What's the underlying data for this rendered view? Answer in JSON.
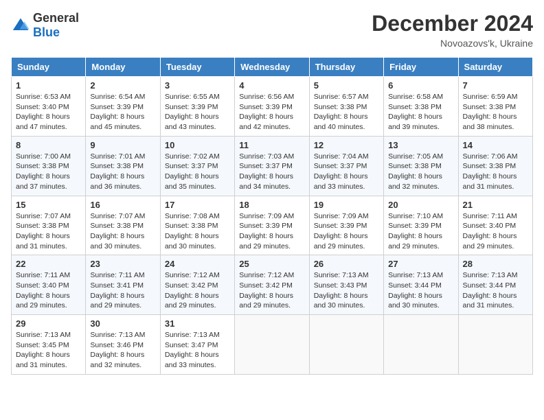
{
  "header": {
    "logo_general": "General",
    "logo_blue": "Blue",
    "month_year": "December 2024",
    "location": "Novoazovs'k, Ukraine"
  },
  "columns": [
    "Sunday",
    "Monday",
    "Tuesday",
    "Wednesday",
    "Thursday",
    "Friday",
    "Saturday"
  ],
  "weeks": [
    [
      {
        "day": "1",
        "sunrise": "6:53 AM",
        "sunset": "3:40 PM",
        "daylight": "8 hours and 47 minutes."
      },
      {
        "day": "2",
        "sunrise": "6:54 AM",
        "sunset": "3:39 PM",
        "daylight": "8 hours and 45 minutes."
      },
      {
        "day": "3",
        "sunrise": "6:55 AM",
        "sunset": "3:39 PM",
        "daylight": "8 hours and 43 minutes."
      },
      {
        "day": "4",
        "sunrise": "6:56 AM",
        "sunset": "3:39 PM",
        "daylight": "8 hours and 42 minutes."
      },
      {
        "day": "5",
        "sunrise": "6:57 AM",
        "sunset": "3:38 PM",
        "daylight": "8 hours and 40 minutes."
      },
      {
        "day": "6",
        "sunrise": "6:58 AM",
        "sunset": "3:38 PM",
        "daylight": "8 hours and 39 minutes."
      },
      {
        "day": "7",
        "sunrise": "6:59 AM",
        "sunset": "3:38 PM",
        "daylight": "8 hours and 38 minutes."
      }
    ],
    [
      {
        "day": "8",
        "sunrise": "7:00 AM",
        "sunset": "3:38 PM",
        "daylight": "8 hours and 37 minutes."
      },
      {
        "day": "9",
        "sunrise": "7:01 AM",
        "sunset": "3:38 PM",
        "daylight": "8 hours and 36 minutes."
      },
      {
        "day": "10",
        "sunrise": "7:02 AM",
        "sunset": "3:37 PM",
        "daylight": "8 hours and 35 minutes."
      },
      {
        "day": "11",
        "sunrise": "7:03 AM",
        "sunset": "3:37 PM",
        "daylight": "8 hours and 34 minutes."
      },
      {
        "day": "12",
        "sunrise": "7:04 AM",
        "sunset": "3:37 PM",
        "daylight": "8 hours and 33 minutes."
      },
      {
        "day": "13",
        "sunrise": "7:05 AM",
        "sunset": "3:38 PM",
        "daylight": "8 hours and 32 minutes."
      },
      {
        "day": "14",
        "sunrise": "7:06 AM",
        "sunset": "3:38 PM",
        "daylight": "8 hours and 31 minutes."
      }
    ],
    [
      {
        "day": "15",
        "sunrise": "7:07 AM",
        "sunset": "3:38 PM",
        "daylight": "8 hours and 31 minutes."
      },
      {
        "day": "16",
        "sunrise": "7:07 AM",
        "sunset": "3:38 PM",
        "daylight": "8 hours and 30 minutes."
      },
      {
        "day": "17",
        "sunrise": "7:08 AM",
        "sunset": "3:38 PM",
        "daylight": "8 hours and 30 minutes."
      },
      {
        "day": "18",
        "sunrise": "7:09 AM",
        "sunset": "3:39 PM",
        "daylight": "8 hours and 29 minutes."
      },
      {
        "day": "19",
        "sunrise": "7:09 AM",
        "sunset": "3:39 PM",
        "daylight": "8 hours and 29 minutes."
      },
      {
        "day": "20",
        "sunrise": "7:10 AM",
        "sunset": "3:39 PM",
        "daylight": "8 hours and 29 minutes."
      },
      {
        "day": "21",
        "sunrise": "7:11 AM",
        "sunset": "3:40 PM",
        "daylight": "8 hours and 29 minutes."
      }
    ],
    [
      {
        "day": "22",
        "sunrise": "7:11 AM",
        "sunset": "3:40 PM",
        "daylight": "8 hours and 29 minutes."
      },
      {
        "day": "23",
        "sunrise": "7:11 AM",
        "sunset": "3:41 PM",
        "daylight": "8 hours and 29 minutes."
      },
      {
        "day": "24",
        "sunrise": "7:12 AM",
        "sunset": "3:42 PM",
        "daylight": "8 hours and 29 minutes."
      },
      {
        "day": "25",
        "sunrise": "7:12 AM",
        "sunset": "3:42 PM",
        "daylight": "8 hours and 29 minutes."
      },
      {
        "day": "26",
        "sunrise": "7:13 AM",
        "sunset": "3:43 PM",
        "daylight": "8 hours and 30 minutes."
      },
      {
        "day": "27",
        "sunrise": "7:13 AM",
        "sunset": "3:44 PM",
        "daylight": "8 hours and 30 minutes."
      },
      {
        "day": "28",
        "sunrise": "7:13 AM",
        "sunset": "3:44 PM",
        "daylight": "8 hours and 31 minutes."
      }
    ],
    [
      {
        "day": "29",
        "sunrise": "7:13 AM",
        "sunset": "3:45 PM",
        "daylight": "8 hours and 31 minutes."
      },
      {
        "day": "30",
        "sunrise": "7:13 AM",
        "sunset": "3:46 PM",
        "daylight": "8 hours and 32 minutes."
      },
      {
        "day": "31",
        "sunrise": "7:13 AM",
        "sunset": "3:47 PM",
        "daylight": "8 hours and 33 minutes."
      },
      null,
      null,
      null,
      null
    ]
  ]
}
